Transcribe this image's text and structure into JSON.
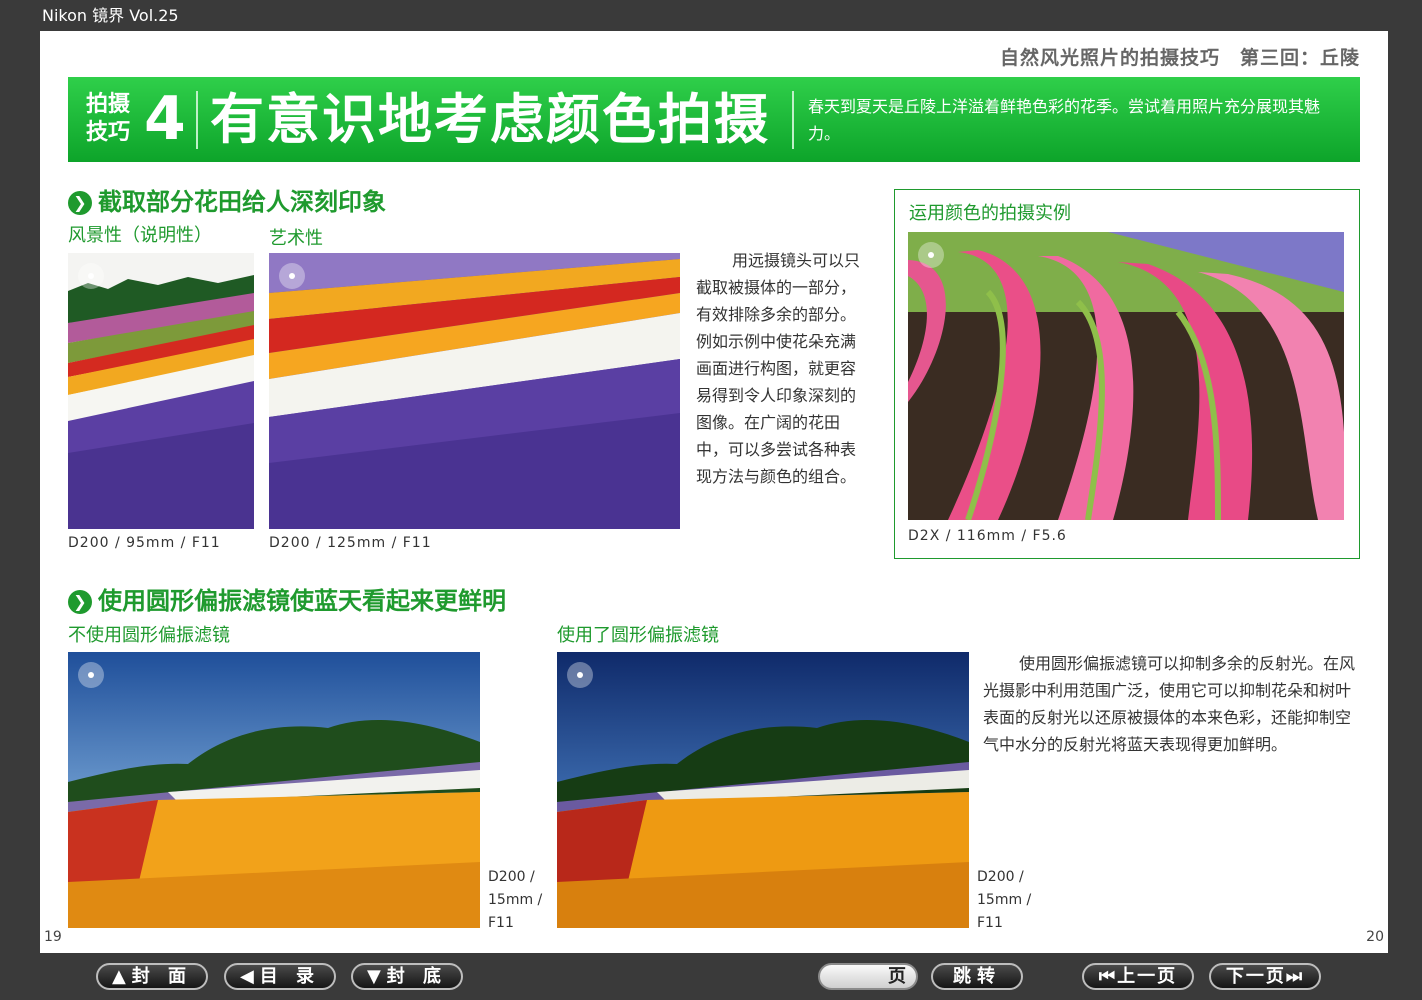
{
  "app": {
    "title": "Nikon 镜界 Vol.25"
  },
  "header": {
    "series": "自然风光照片的拍摄技巧　第三回：丘陵"
  },
  "banner": {
    "tip_label": "拍摄技巧",
    "tip_number": "4",
    "title": "有意识地考虑颜色拍摄",
    "description": "春天到夏天是丘陵上洋溢着鲜艳色彩的花季。尝试着用照片充分展现其魅力。"
  },
  "section1": {
    "heading": "截取部分花田给人深刻印象",
    "photo_a": {
      "label": "风景性（说明性）",
      "caption": "D200 / 95mm / F11"
    },
    "photo_b": {
      "label": "艺术性",
      "caption": "D200 / 125mm / F11"
    },
    "body": "用远摄镜头可以只截取被摄体的一部分，有效排除多余的部分。例如示例中使花朵充满画面进行构图，就更容易得到令人印象深刻的图像。在广阔的花田中，可以多尝试各种表现方法与颜色的组合。"
  },
  "example_box": {
    "title": "运用颜色的拍摄实例",
    "caption": "D2X / 116mm / F5.6"
  },
  "section2": {
    "heading": "使用圆形偏振滤镜使蓝天看起来更鲜明",
    "photo_a": {
      "label": "不使用圆形偏振滤镜",
      "caption_lines": [
        "D200 /",
        "15mm /",
        "F11"
      ]
    },
    "photo_b": {
      "label": "使用了圆形偏振滤镜",
      "caption_lines": [
        "D200 /",
        "15mm /",
        "F11"
      ]
    },
    "body": "使用圆形偏振滤镜可以抑制多余的反射光。在风光摄影中利用范围广泛，使用它可以抑制花朵和树叶表面的反射光以还原被摄体的本来色彩，还能抑制空气中水分的反射光将蓝天表现得更加鲜明。"
  },
  "page_numbers": {
    "left": "19",
    "right": "20"
  },
  "toolbar": {
    "cover": "▲封 面",
    "contents": "◀目 录",
    "back_cover": "▼封 底",
    "page_suffix": "页",
    "jump": "跳转",
    "prev": "⏮上一页",
    "next": "下一页⏭"
  }
}
